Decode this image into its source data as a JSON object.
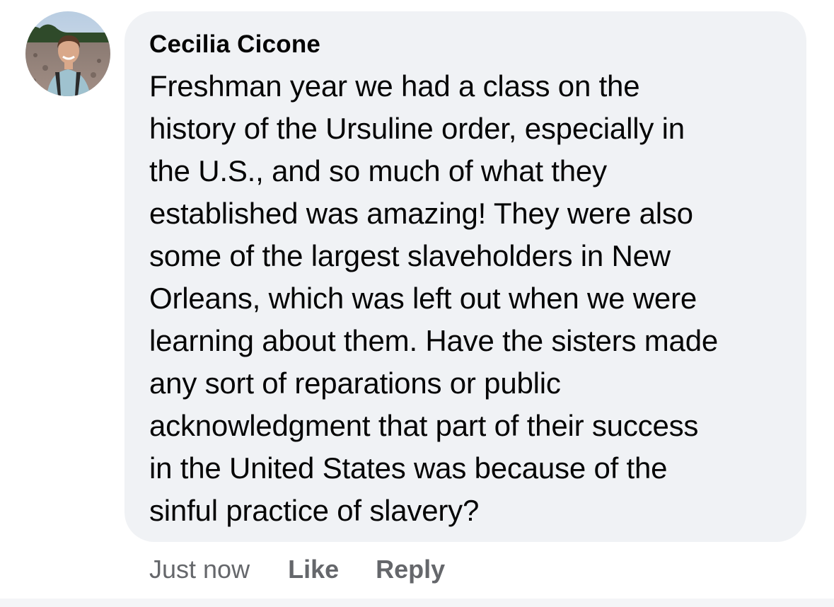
{
  "comment": {
    "author": "Cecilia Cicone",
    "text": "Freshman year we had a class on the\nhistory of the Ursuline order, especially in\nthe U.S., and so much of what they\nestablished was amazing! They were also\nsome of the largest slaveholders in New\nOrleans, which was left out when we were\nlearning about them. Have the sisters made\nany sort of reparations or public\nacknowledgment that part of their success\nin the United States was because of the\nsinful practice of slavery?",
    "avatar_icon": "profile-photo",
    "timestamp": "Just now",
    "like_label": "Like",
    "reply_label": "Reply"
  },
  "colors": {
    "bubble_background": "#f0f2f5",
    "primary_text": "#050505",
    "secondary_text": "#65676b"
  }
}
